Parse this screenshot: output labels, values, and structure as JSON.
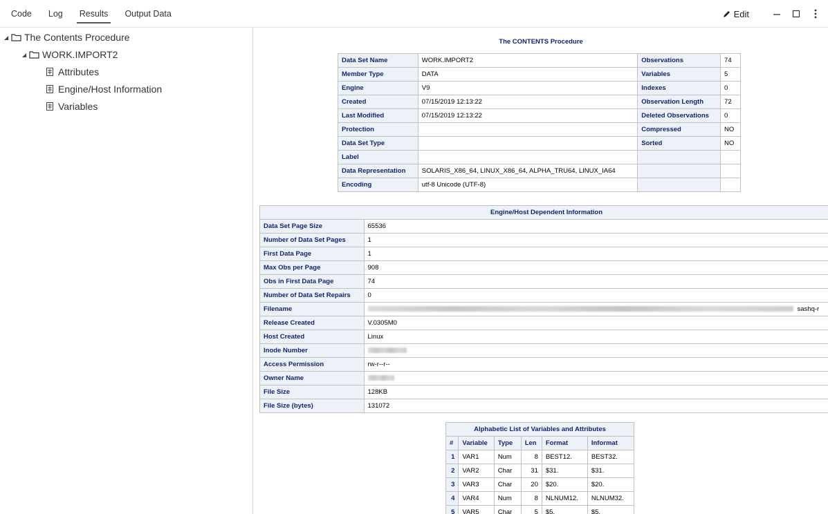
{
  "tabs": [
    "Code",
    "Log",
    "Results",
    "Output Data"
  ],
  "active_tab": "Results",
  "toolbar": {
    "edit_label": "Edit"
  },
  "tree": {
    "root": "The Contents Procedure",
    "child": "WORK.IMPORT2",
    "leaves": [
      "Attributes",
      "Engine/Host Information",
      "Variables"
    ]
  },
  "contents": {
    "title": "The CONTENTS Procedure",
    "rows": [
      [
        "Data Set Name",
        "WORK.IMPORT2",
        "Observations",
        "74"
      ],
      [
        "Member Type",
        "DATA",
        "Variables",
        "5"
      ],
      [
        "Engine",
        "V9",
        "Indexes",
        "0"
      ],
      [
        "Created",
        "07/15/2019 12:13:22",
        "Observation Length",
        "72"
      ],
      [
        "Last Modified",
        "07/15/2019 12:13:22",
        "Deleted Observations",
        "0"
      ],
      [
        "Protection",
        "",
        "Compressed",
        "NO"
      ],
      [
        "Data Set Type",
        "",
        "Sorted",
        "NO"
      ],
      [
        "Label",
        "",
        "",
        ""
      ],
      [
        "Data Representation",
        "SOLARIS_X86_64, LINUX_X86_64, ALPHA_TRU64, LINUX_IA64",
        "",
        ""
      ],
      [
        "Encoding",
        "utf-8 Unicode (UTF-8)",
        "",
        ""
      ]
    ]
  },
  "engine": {
    "caption": "Engine/Host Dependent Information",
    "rows": [
      [
        "Data Set Page Size",
        "65536"
      ],
      [
        "Number of Data Set Pages",
        "1"
      ],
      [
        "First Data Page",
        "1"
      ],
      [
        "Max Obs per Page",
        "908"
      ],
      [
        "Obs in First Data Page",
        "74"
      ],
      [
        "Number of Data Set Repairs",
        "0"
      ],
      [
        "Filename",
        "sashq-r"
      ],
      [
        "Release Created",
        "V.0305M0"
      ],
      [
        "Host Created",
        "Linux"
      ],
      [
        "Inode Number",
        ""
      ],
      [
        "Access Permission",
        "rw-r--r--"
      ],
      [
        "Owner Name",
        ""
      ],
      [
        "File Size",
        "128KB"
      ],
      [
        "File Size (bytes)",
        "131072"
      ]
    ]
  },
  "variables": {
    "caption": "Alphabetic List of Variables and Attributes",
    "headers": [
      "#",
      "Variable",
      "Type",
      "Len",
      "Format",
      "Informat"
    ],
    "rows": [
      [
        "1",
        "VAR1",
        "Num",
        "8",
        "BEST12.",
        "BEST32."
      ],
      [
        "2",
        "VAR2",
        "Char",
        "31",
        "$31.",
        "$31."
      ],
      [
        "3",
        "VAR3",
        "Char",
        "20",
        "$20.",
        "$20."
      ],
      [
        "4",
        "VAR4",
        "Num",
        "8",
        "NLNUM12.",
        "NLNUM32."
      ],
      [
        "5",
        "VAR5",
        "Char",
        "5",
        "$5.",
        "$5."
      ]
    ]
  }
}
